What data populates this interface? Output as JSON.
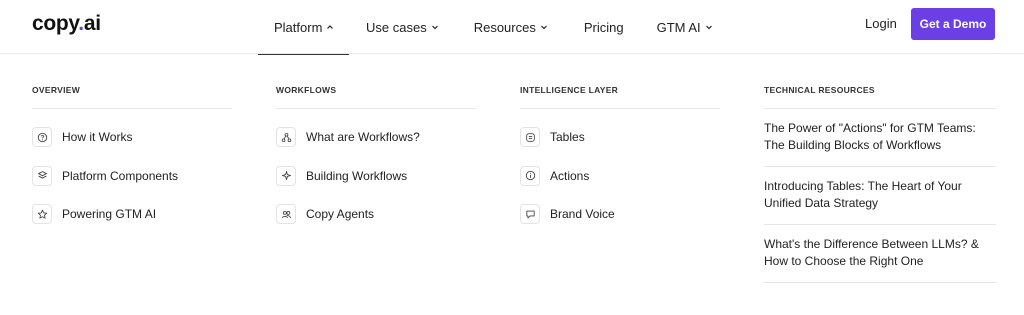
{
  "logo": {
    "text": "copy",
    "dot": ".",
    "suffix": "ai"
  },
  "nav": {
    "items": [
      {
        "label": "Platform"
      },
      {
        "label": "Use cases"
      },
      {
        "label": "Resources"
      },
      {
        "label": "Pricing"
      },
      {
        "label": "GTM AI"
      }
    ],
    "login": "Login",
    "cta": "Get a Demo",
    "accent_color": "#6b3fe6"
  },
  "menu": {
    "overview": {
      "title": "OVERVIEW",
      "items": [
        {
          "label": "How it Works",
          "icon": "question-circle-icon"
        },
        {
          "label": "Platform Components",
          "icon": "layers-icon"
        },
        {
          "label": "Powering GTM AI",
          "icon": "star-icon"
        }
      ]
    },
    "workflows": {
      "title": "WORKFLOWS",
      "items": [
        {
          "label": "What are Workflows?",
          "icon": "workflow-nodes-icon"
        },
        {
          "label": "Building Workflows",
          "icon": "sparkle-icon"
        },
        {
          "label": "Copy Agents",
          "icon": "agents-icon"
        }
      ]
    },
    "intelligence": {
      "title": "INTELLIGENCE LAYER",
      "items": [
        {
          "label": "Tables",
          "icon": "table-icon"
        },
        {
          "label": "Actions",
          "icon": "info-circle-icon"
        },
        {
          "label": "Brand Voice",
          "icon": "chat-icon"
        }
      ]
    },
    "technical": {
      "title": "TECHNICAL RESOURCES",
      "links": [
        "The Power of \"Actions\" for GTM Teams: The Building Blocks of Workflows",
        "Introducing Tables: The Heart of Your Unified Data Strategy",
        "What's the Difference Between LLMs? & How to Choose the Right One"
      ]
    }
  }
}
